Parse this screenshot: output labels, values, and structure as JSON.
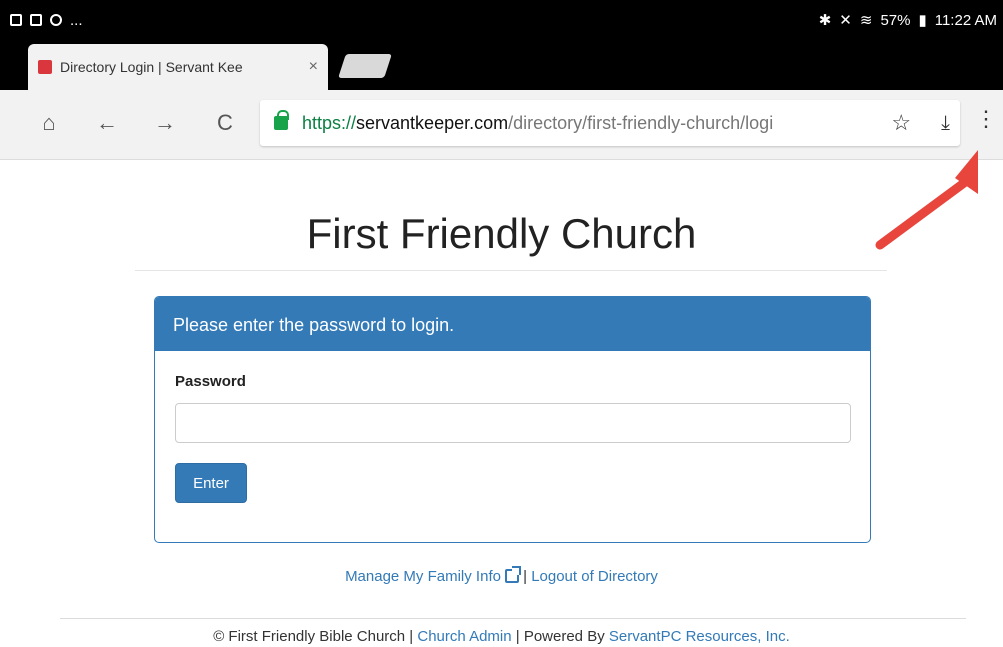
{
  "status": {
    "left_extra": "...",
    "battery": "57%",
    "time": "11:22 AM"
  },
  "tab": {
    "title": "Directory Login | Servant Kee",
    "close": "×"
  },
  "toolbar": {
    "home": "⌂",
    "back": "←",
    "forward": "→",
    "reload": "C",
    "url_scheme": "https://",
    "url_host": "servantkeeper.com",
    "url_path": "/directory/first-friendly-church/logi",
    "star": "☆",
    "download": "⤓",
    "menu": "⋮"
  },
  "page": {
    "title": "First Friendly Church"
  },
  "panel": {
    "heading": "Please enter the password to login.",
    "password_label": "Password",
    "password_value": "",
    "enter_label": "Enter"
  },
  "links": {
    "manage": "Manage My Family Info",
    "separator": " | ",
    "logout": "Logout of Directory"
  },
  "footer": {
    "copyright": "© First Friendly Bible Church | ",
    "church_admin": "Church Admin",
    "powered_by": " | Powered By ",
    "servantpc": "ServantPC Resources, Inc."
  },
  "colors": {
    "accent": "#337ab7",
    "annotation_arrow": "#e8453c"
  }
}
